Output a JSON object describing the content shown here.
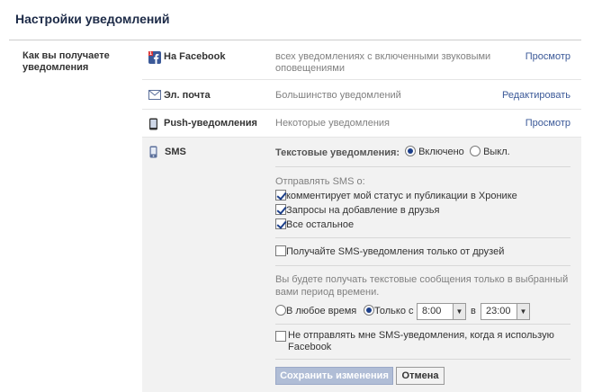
{
  "page": {
    "title": "Настройки уведомлений",
    "left_label": "Как вы получаете уведомления"
  },
  "rows": [
    {
      "name": "На Facebook",
      "description": "всех уведомлениях с включенными звуковыми оповещениями",
      "action": "Просмотр",
      "icon": "facebook-icon"
    },
    {
      "name": "Эл. почта",
      "description": "Большинство уведомлений",
      "action": "Редактировать",
      "icon": "envelope-icon"
    },
    {
      "name": "Push-уведомления",
      "description": "Некоторые уведомления",
      "action": "Просмотр",
      "icon": "phone-icon"
    }
  ],
  "sms": {
    "name": "SMS",
    "icon": "mobile-icon",
    "text_notifications_label": "Текстовые уведомления:",
    "on_label": "Включено",
    "off_label": "Выкл.",
    "send_about_label": "Отправлять SMS о:",
    "options": [
      {
        "label": "комментирует мой статус и публикации в Хронике",
        "checked": true
      },
      {
        "label": "Запросы на добавление в друзья",
        "checked": true
      },
      {
        "label": "Все остальное",
        "checked": true
      }
    ],
    "friends_only_label": "Получайте SMS-уведомления только от друзей",
    "time_info": "Вы будете получать текстовые сообщения только в выбранный вами период времени.",
    "anytime_label": "В любое время",
    "only_from_label": "Только с",
    "from_time": "8:00",
    "to_label": "в",
    "to_time": "23:00",
    "dont_send_label": "Не отправлять мне SMS-уведомления, когда я использую Facebook",
    "save_button": "Сохранить изменения",
    "cancel_button": "Отмена"
  },
  "colors": {
    "link": "#3b5998",
    "title": "#1c2a47",
    "panel_bg": "#f2f2f2",
    "save_bg": "#b0bdd6"
  }
}
